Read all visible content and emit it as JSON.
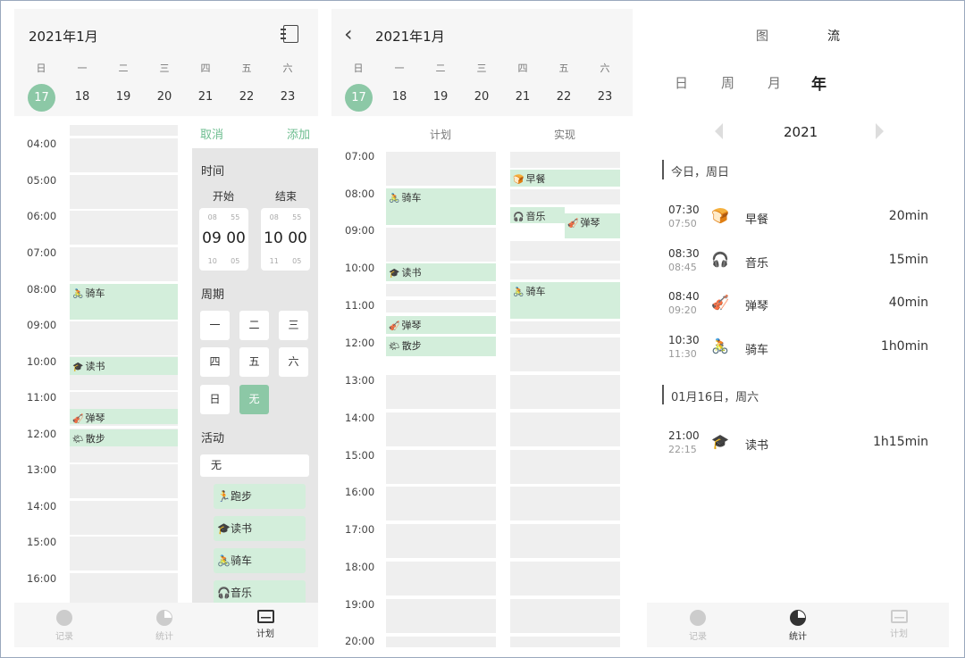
{
  "panel1": {
    "month": "2021年1月",
    "weekdays": [
      "日",
      "一",
      "二",
      "三",
      "四",
      "五",
      "六"
    ],
    "dates": [
      "17",
      "18",
      "19",
      "20",
      "21",
      "22",
      "23"
    ],
    "hours": [
      "04:00",
      "05:00",
      "06:00",
      "07:00",
      "08:00",
      "09:00",
      "10:00",
      "11:00",
      "12:00",
      "13:00",
      "14:00",
      "15:00",
      "16:00"
    ],
    "events": [
      {
        "icon": "🚴",
        "label": "骑车"
      },
      {
        "icon": "🎓",
        "label": "读书"
      },
      {
        "icon": "🎻",
        "label": "弹琴"
      },
      {
        "icon": "🌤",
        "label": "散步"
      }
    ],
    "overlay": {
      "cancel": "取消",
      "add": "添加",
      "time_label": "时间",
      "start_label": "开始",
      "end_label": "结束",
      "start": {
        "above_h": "08",
        "above_m": "55",
        "big": "09 00",
        "below_h": "10",
        "below_m": "05"
      },
      "end": {
        "above_h": "08",
        "above_m": "55",
        "big": "10 00",
        "below_h": "11",
        "below_m": "05"
      },
      "period_label": "周期",
      "period_buttons": [
        "一",
        "二",
        "三",
        "四",
        "五",
        "六",
        "日",
        "无"
      ],
      "activity_label": "活动",
      "activity_value": "无",
      "activities": [
        {
          "icon": "🏃",
          "label": "跑步"
        },
        {
          "icon": "🎓",
          "label": "读书"
        },
        {
          "icon": "🚴",
          "label": "骑车"
        },
        {
          "icon": "🎧",
          "label": "音乐"
        }
      ]
    },
    "nav": [
      {
        "label": "记录"
      },
      {
        "label": "统计"
      },
      {
        "label": "计划"
      }
    ]
  },
  "panel2": {
    "back": "‹",
    "month": "2021年1月",
    "weekdays": [
      "日",
      "一",
      "二",
      "三",
      "四",
      "五",
      "六"
    ],
    "dates": [
      "17",
      "18",
      "19",
      "20",
      "21",
      "22",
      "23"
    ],
    "col_plan": "计划",
    "col_actual": "实现",
    "hours": [
      "07:00",
      "08:00",
      "09:00",
      "10:00",
      "11:00",
      "12:00",
      "13:00",
      "14:00",
      "15:00",
      "16:00",
      "17:00",
      "18:00",
      "19:00",
      "20:00"
    ],
    "plan_events": [
      {
        "icon": "🚴",
        "label": "骑车"
      },
      {
        "icon": "🎓",
        "label": "读书"
      },
      {
        "icon": "🎻",
        "label": "弹琴"
      },
      {
        "icon": "🌤",
        "label": "散步"
      }
    ],
    "actual_events": [
      {
        "icon": "🍞",
        "label": "早餐"
      },
      {
        "icon": "🎧",
        "label": "音乐"
      },
      {
        "icon": "🎻",
        "label": "弹琴"
      },
      {
        "icon": "🚴",
        "label": "骑车"
      }
    ]
  },
  "panel3": {
    "tabs": [
      "图",
      "流"
    ],
    "periods": [
      "日",
      "周",
      "月",
      "年"
    ],
    "year": "2021",
    "section1": "今日，周日",
    "rows1": [
      {
        "start": "07:30",
        "end": "07:50",
        "icon": "🍞",
        "name": "早餐",
        "dur": "20min"
      },
      {
        "start": "08:30",
        "end": "08:45",
        "icon": "🎧",
        "name": "音乐",
        "dur": "15min"
      },
      {
        "start": "08:40",
        "end": "09:20",
        "icon": "🎻",
        "name": "弹琴",
        "dur": "40min"
      },
      {
        "start": "10:30",
        "end": "11:30",
        "icon": "🚴",
        "name": "骑车",
        "dur": "1h0min"
      }
    ],
    "section2": "01月16日，周六",
    "rows2": [
      {
        "start": "21:00",
        "end": "22:15",
        "icon": "🎓",
        "name": "读书",
        "dur": "1h15min"
      }
    ],
    "nav": [
      {
        "label": "记录"
      },
      {
        "label": "统计"
      },
      {
        "label": "计划"
      }
    ]
  },
  "colors": {
    "accent": "#8cc8a6",
    "event": "#d3eedb",
    "cell": "#efefef"
  }
}
